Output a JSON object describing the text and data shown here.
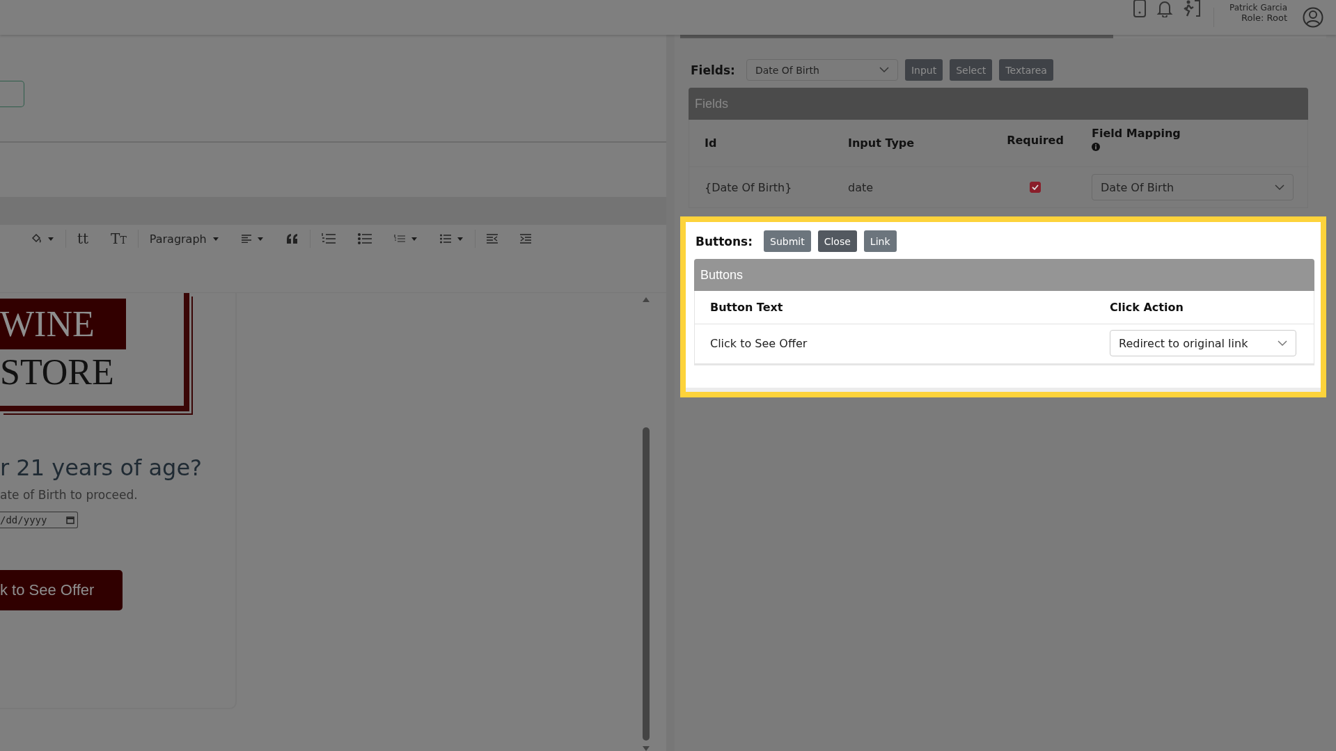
{
  "header": {
    "user_name": "Patrick Garcia",
    "role": "Role: Root"
  },
  "editor": {
    "toolbar": [
      {
        "kind": "icon",
        "caret": true
      },
      {
        "kind": "sep"
      },
      {
        "kind": "text",
        "label": "tt"
      },
      {
        "kind": "caps",
        "label": "Tt"
      },
      {
        "kind": "sep"
      },
      {
        "kind": "dropdown",
        "label": "Paragraph"
      },
      {
        "kind": "icon",
        "caret": true
      },
      {
        "kind": "icon",
        "caret": false
      },
      {
        "kind": "sep"
      },
      {
        "kind": "icon",
        "caret": false
      },
      {
        "kind": "icon",
        "caret": false
      },
      {
        "kind": "icon",
        "caret": true
      },
      {
        "kind": "icon",
        "caret": true
      },
      {
        "kind": "sep"
      },
      {
        "kind": "icon",
        "caret": false
      },
      {
        "kind": "icon",
        "caret": false
      }
    ],
    "preview": {
      "logo_top": "WINE",
      "logo_bottom": "STORE",
      "heading": "r 21 years of age?",
      "subtext": "ate of Birth to proceed.",
      "date_placeholder": "/dd/yyyy",
      "button": "k to See Offer"
    }
  },
  "progress": {
    "level": 0.67
  },
  "fields_bar": {
    "label": "Fields:",
    "select": "Date Of Birth",
    "buttons": [
      {
        "label": "Input"
      },
      {
        "label": "Select"
      },
      {
        "label": "Textarea"
      }
    ]
  },
  "fields_card": {
    "title": "Fields",
    "columns": [
      "Id",
      "Input Type",
      "Required",
      "Field Mapping"
    ],
    "rows": [
      {
        "id": "{Date Of Birth}",
        "input_type": "date",
        "required": true,
        "mapping": "Date Of Birth"
      }
    ]
  },
  "buttons_bar": {
    "label": "Buttons:",
    "buttons": [
      {
        "label": "Submit",
        "selected": false
      },
      {
        "label": "Close",
        "selected": true
      },
      {
        "label": "Link",
        "selected": false
      }
    ]
  },
  "buttons_card": {
    "title": "Buttons",
    "columns": [
      "Button Text",
      "Click Action"
    ],
    "rows": [
      {
        "text": "Click to See Offer",
        "action": "Redirect to original link"
      }
    ]
  }
}
